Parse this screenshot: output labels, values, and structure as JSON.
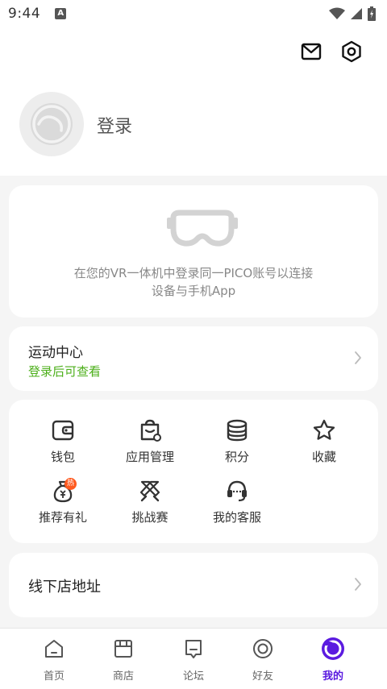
{
  "status_bar": {
    "time": "9:44",
    "notification_letter": "A"
  },
  "header": {
    "icons": [
      "mail-icon",
      "settings-icon"
    ],
    "login_label": "登录"
  },
  "vr_card": {
    "line1": "在您的VR一体机中登录同一PICO账号以连接",
    "line2": "设备与手机App"
  },
  "sport_card": {
    "title": "运动中心",
    "subtitle": "登录后可查看"
  },
  "grid": {
    "items": [
      {
        "label": "钱包",
        "icon": "wallet-icon"
      },
      {
        "label": "应用管理",
        "icon": "app-manage-icon"
      },
      {
        "label": "积分",
        "icon": "points-icon"
      },
      {
        "label": "收藏",
        "icon": "star-icon"
      },
      {
        "label": "推荐有礼",
        "icon": "referral-bag-icon",
        "badge": "热"
      },
      {
        "label": "挑战赛",
        "icon": "crossed-swords-icon"
      },
      {
        "label": "我的客服",
        "icon": "headset-icon"
      }
    ]
  },
  "store_card": {
    "title": "线下店地址"
  },
  "bottom_nav": {
    "items": [
      {
        "label": "首页",
        "icon": "home-icon"
      },
      {
        "label": "商店",
        "icon": "store-icon"
      },
      {
        "label": "论坛",
        "icon": "forum-icon"
      },
      {
        "label": "好友",
        "icon": "friends-icon"
      },
      {
        "label": "我的",
        "icon": "profile-icon",
        "active": true
      }
    ]
  },
  "colors": {
    "accent": "#5b1be0",
    "green_hint": "#4caf1a",
    "hot_badge": "#ff5a1f",
    "background": "#f5f5f5"
  }
}
